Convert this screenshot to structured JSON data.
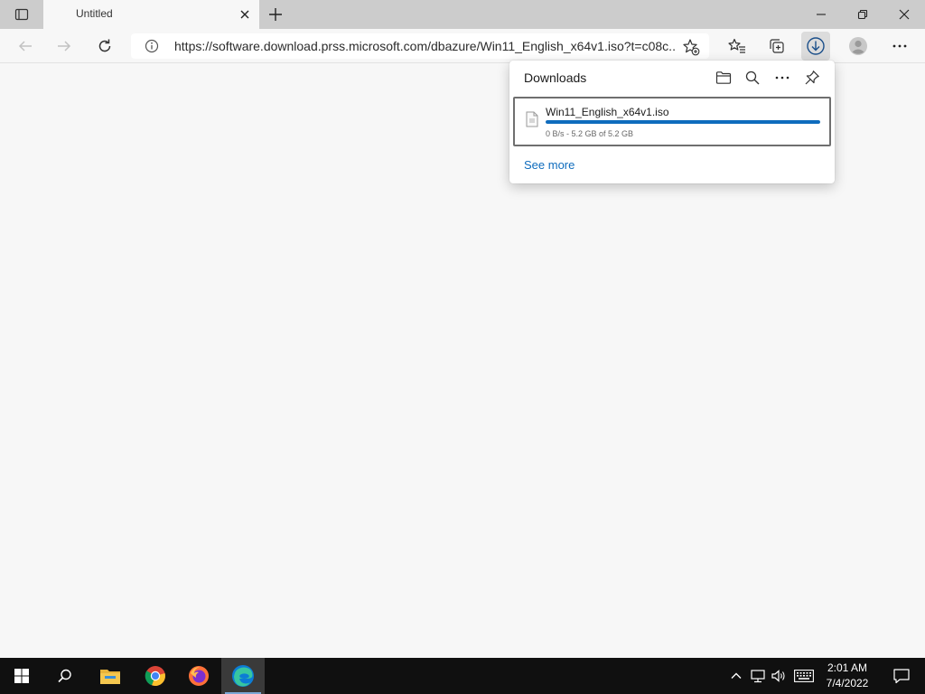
{
  "browser": {
    "tab": {
      "title": "Untitled"
    },
    "address": {
      "url": "https://software.download.prss.microsoft.com/dbazure/Win11_English_x64v1.iso?t=c08c..."
    }
  },
  "downloads": {
    "title": "Downloads",
    "items": [
      {
        "filename": "Win11_English_x64v1.iso",
        "status": "0 B/s - 5.2 GB of 5.2 GB",
        "progress_percent": 100
      }
    ],
    "see_more": "See more"
  },
  "taskbar": {
    "clock": {
      "time": "2:01 AM",
      "date": "7/4/2022"
    },
    "pinned": [
      "windows-start-icon",
      "search-icon",
      "file-explorer-icon",
      "chrome-icon",
      "firefox-icon",
      "edge-icon"
    ]
  },
  "colors": {
    "accent": "#0f6cbd",
    "titlebar": "#cccccc",
    "page_background": "#f7f7f7",
    "taskbar": "#101010"
  }
}
